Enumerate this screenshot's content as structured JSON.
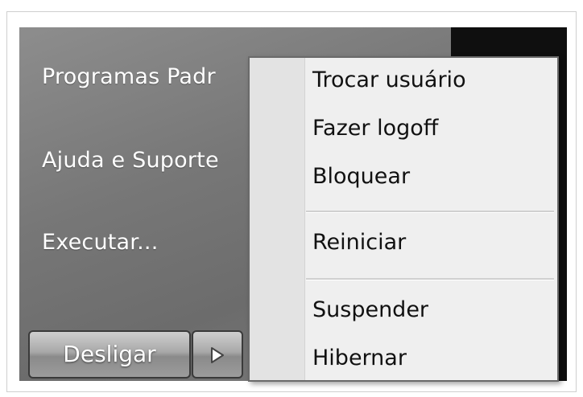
{
  "start_menu": {
    "items": [
      {
        "label": "Programas Padr"
      },
      {
        "label": "Ajuda e Suporte"
      },
      {
        "label": "Executar..."
      }
    ],
    "shutdown_label": "Desligar",
    "arrow_icon": "triangle-right-icon"
  },
  "context_menu": {
    "items": [
      {
        "label": "Trocar usuário"
      },
      {
        "label": "Fazer logoff"
      },
      {
        "label": "Bloquear"
      },
      {
        "label": "Reiniciar"
      },
      {
        "label": "Suspender"
      },
      {
        "label": "Hibernar"
      }
    ]
  },
  "colors": {
    "panel": "#777777",
    "dark_panel": "#0f0f0f",
    "menu_bg": "#efefef"
  }
}
